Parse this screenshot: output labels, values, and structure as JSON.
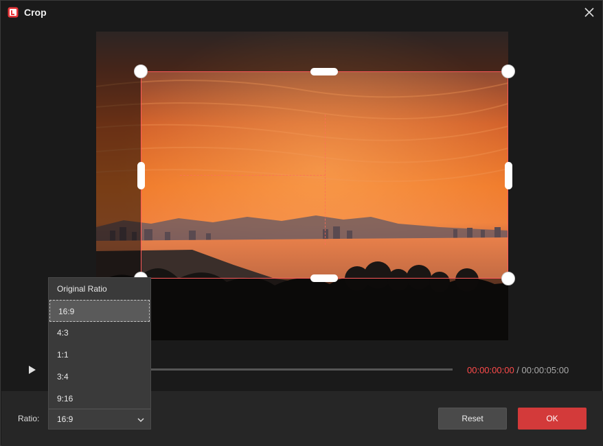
{
  "window": {
    "title": "Crop",
    "app_icon": "app-logo-icon",
    "close_icon": "close-icon"
  },
  "preview": {
    "image_description_icon": "sunset-coastline-photo"
  },
  "playback": {
    "play_icon": "play-icon",
    "current_time": "00:00:00:00",
    "separator": " / ",
    "total_time": "00:00:05:00"
  },
  "ratio": {
    "label": "Ratio:",
    "selected": "16:9",
    "options": [
      "Original Ratio",
      "16:9",
      "4:3",
      "1:1",
      "3:4",
      "9:16"
    ]
  },
  "buttons": {
    "reset_label": "Reset",
    "ok_label": "OK"
  },
  "colors": {
    "accent": "#d33a3a",
    "time_current": "#ff4b4b",
    "crop_border": "#ff5a5a"
  }
}
